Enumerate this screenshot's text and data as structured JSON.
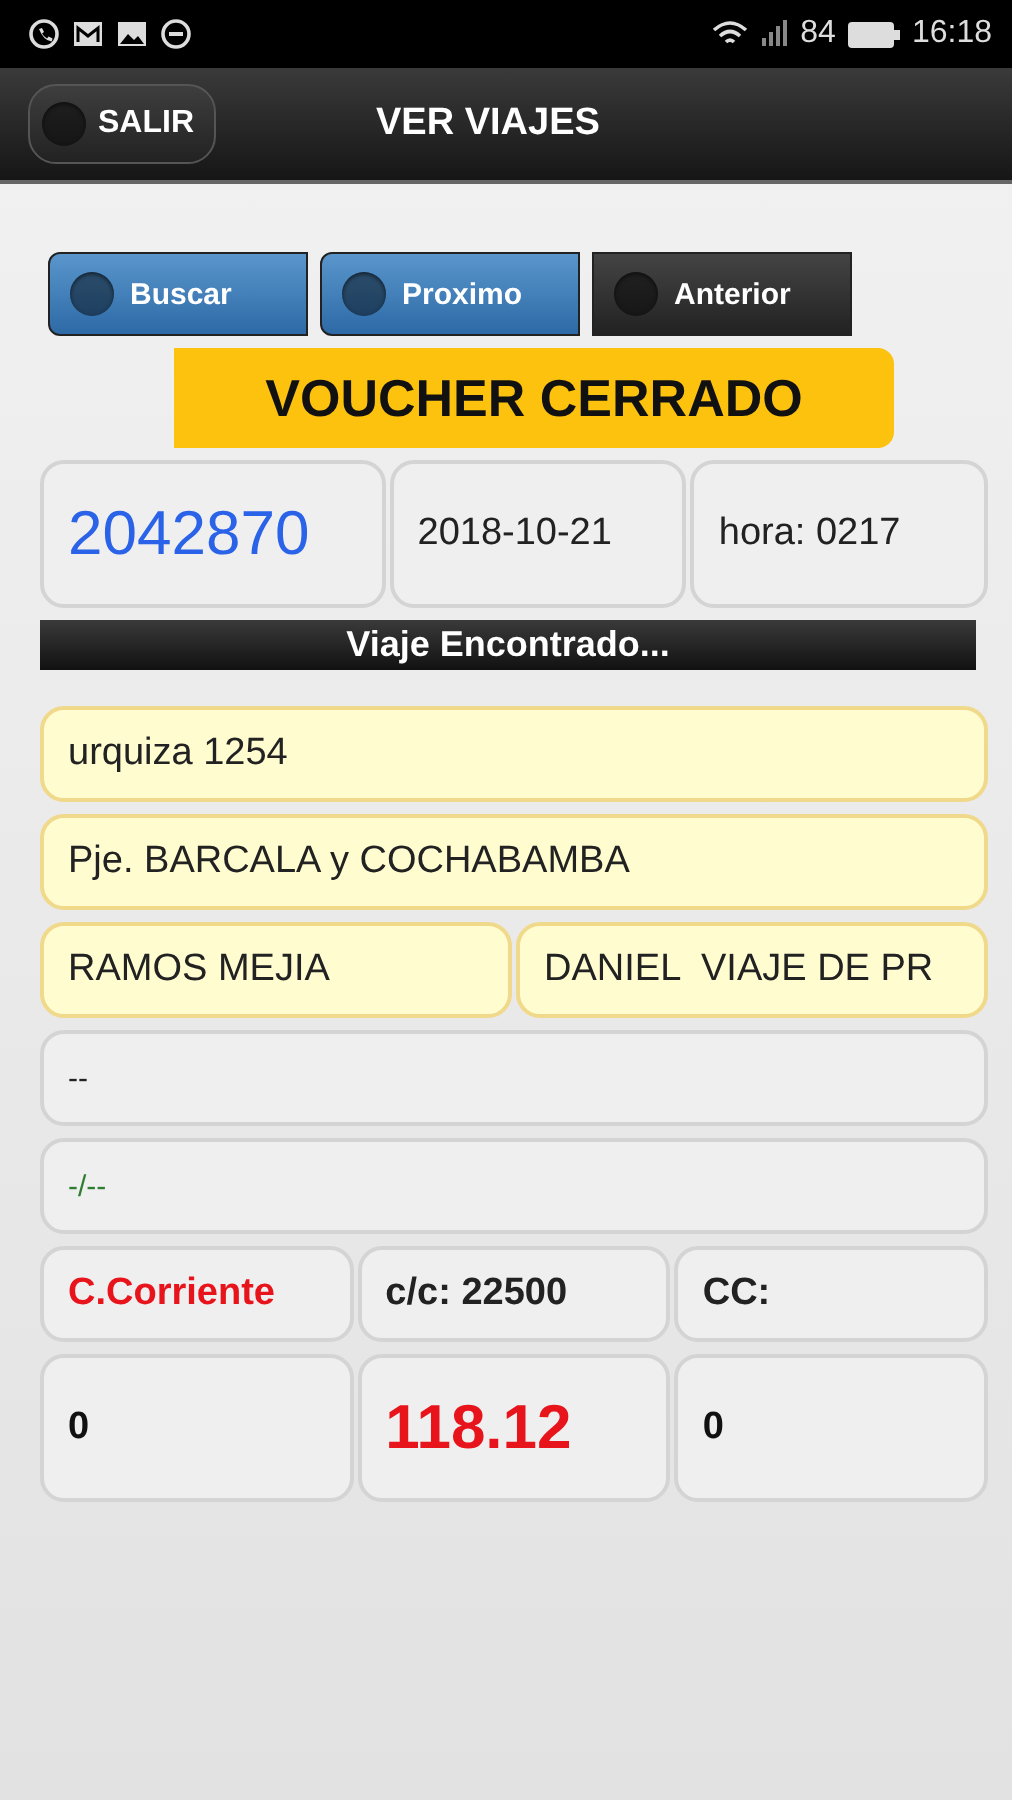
{
  "status_bar": {
    "battery": "84",
    "time": "16:18"
  },
  "header": {
    "exit_button": "SALIR",
    "title": "VER VIAJES"
  },
  "nav_buttons": [
    {
      "label": "Buscar",
      "kind": "blue"
    },
    {
      "label": "Proximo",
      "kind": "blue"
    },
    {
      "label": "Anterior",
      "kind": "dark"
    }
  ],
  "status_banner": "VOUCHER CERRADO",
  "sections": [
    {
      "kind": "plain",
      "cells": [
        {
          "text": "2042870",
          "color": "#2a62e8",
          "kind": "large"
        },
        {
          "text": "2018-10-21",
          "color": "#222222",
          "kind": "normal"
        },
        {
          "text": "hora: 0217",
          "color": "#222222",
          "kind": "normal"
        }
      ]
    },
    {
      "kind": "banner",
      "text": "Viaje Encontrado..."
    },
    {
      "kind": "yellow",
      "cells": [
        {
          "text": "urquiza 1254",
          "color": "#222222",
          "kind": "normal"
        }
      ]
    },
    {
      "kind": "yellow",
      "cells": [
        {
          "text": "Pje. BARCALA y COCHABAMBA",
          "color": "#222222",
          "kind": "normal"
        }
      ]
    },
    {
      "kind": "yellow",
      "cells": [
        {
          "text": "RAMOS MEJIA",
          "color": "#222222",
          "kind": "normal"
        },
        {
          "text": "DANIEL  VIAJE DE PR",
          "color": "#222222",
          "kind": "normal"
        }
      ]
    },
    {
      "kind": "plain",
      "cells": [
        {
          "text": "--",
          "color": "#222222",
          "kind": "small"
        }
      ]
    },
    {
      "kind": "plain",
      "cells": [
        {
          "text": "-/--",
          "color": "#2e7d32",
          "kind": "small"
        }
      ]
    },
    {
      "kind": "plain",
      "cells": [
        {
          "text": "C.Corriente",
          "color": "#e8141c",
          "kind": "bold"
        },
        {
          "text": "c/c: 22500",
          "color": "#222222",
          "kind": "bold"
        },
        {
          "text": "CC:",
          "color": "#222222",
          "kind": "bold"
        }
      ]
    },
    {
      "kind": "plain",
      "cells": [
        {
          "text": "0",
          "color": "#111111",
          "kind": "bold"
        },
        {
          "text": "118.12",
          "color": "#e8141c",
          "kind": "amount"
        },
        {
          "text": "0",
          "color": "#111111",
          "kind": "bold"
        }
      ]
    }
  ]
}
